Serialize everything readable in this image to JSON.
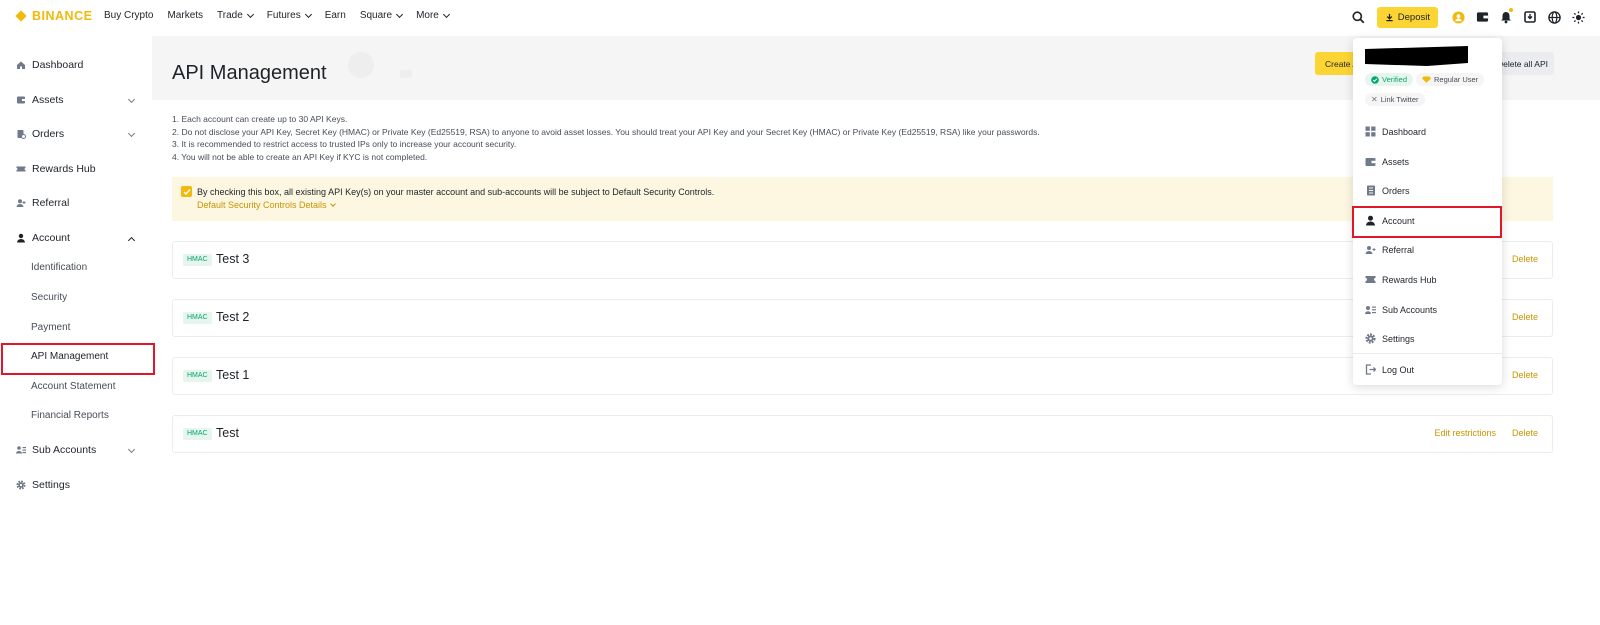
{
  "brand": {
    "name": "BINANCE",
    "color": "#f0b90b"
  },
  "nav": {
    "links": [
      {
        "label": "Buy Crypto",
        "has_dropdown": false
      },
      {
        "label": "Markets",
        "has_dropdown": false
      },
      {
        "label": "Trade",
        "has_dropdown": true
      },
      {
        "label": "Futures",
        "has_dropdown": true
      },
      {
        "label": "Earn",
        "has_dropdown": false
      },
      {
        "label": "Square",
        "has_dropdown": true
      },
      {
        "label": "More",
        "has_dropdown": true
      }
    ],
    "deposit_label": "Deposit"
  },
  "sidebar": {
    "items": [
      {
        "label": "Dashboard",
        "icon": "home-icon"
      },
      {
        "label": "Assets",
        "icon": "wallet-icon"
      },
      {
        "label": "Orders",
        "icon": "orders-icon"
      },
      {
        "label": "Rewards Hub",
        "icon": "ticket-icon"
      },
      {
        "label": "Referral",
        "icon": "add-user-icon"
      },
      {
        "label": "Account",
        "icon": "user-icon"
      },
      {
        "label": "Sub Accounts",
        "icon": "sub-accounts-icon"
      },
      {
        "label": "Settings",
        "icon": "gear-icon"
      }
    ],
    "account_sub": [
      "Identification",
      "Security",
      "Payment",
      "API Management",
      "Account Statement",
      "Financial Reports"
    ]
  },
  "main": {
    "title": "API Management",
    "create_label": "Create API",
    "delete_all_label": "Delete all API",
    "notes": [
      "1. Each account can create up to 30 API Keys.",
      "2. Do not disclose your API Key, Secret Key (HMAC) or Private Key (Ed25519, RSA) to anyone to avoid asset losses. You should treat your API Key and your Secret Key (HMAC) or Private Key (Ed25519, RSA) like your passwords.",
      "3. It is recommended to restrict access to trusted IPs only to increase your account security.",
      "4. You will not be able to create an API Key if KYC is not completed."
    ],
    "notice_text": "By checking this box, all existing API Key(s) on your master account and sub-accounts will be subject to Default Security Controls.",
    "notice_link": "Default Security Controls Details",
    "api_keys": [
      {
        "type": "HMAC",
        "name": "Test 3",
        "delete": "Delete"
      },
      {
        "type": "HMAC",
        "name": "Test 2",
        "delete": "Delete"
      },
      {
        "type": "HMAC",
        "name": "Test 1",
        "delete": "Delete"
      },
      {
        "type": "HMAC",
        "name": "Test",
        "edit": "Edit restrictions",
        "delete": "Delete"
      }
    ]
  },
  "dropdown": {
    "badges": {
      "verified": "Verified",
      "user_level": "Regular User",
      "twitter": "Link Twitter"
    },
    "items": [
      {
        "label": "Dashboard",
        "icon": "grid-icon"
      },
      {
        "label": "Assets",
        "icon": "wallet-icon"
      },
      {
        "label": "Orders",
        "icon": "orders-icon"
      },
      {
        "label": "Account",
        "icon": "user-icon"
      },
      {
        "label": "Referral",
        "icon": "add-user-icon"
      },
      {
        "label": "Rewards Hub",
        "icon": "ticket-icon"
      },
      {
        "label": "Sub Accounts",
        "icon": "sub-accounts-icon"
      },
      {
        "label": "Settings",
        "icon": "gear-icon"
      },
      {
        "label": "Log Out",
        "icon": "logout-icon"
      }
    ]
  },
  "colors": {
    "accent": "#fcd535",
    "link": "#c99400",
    "highlight": "#e0162b",
    "success": "#03a66d"
  }
}
